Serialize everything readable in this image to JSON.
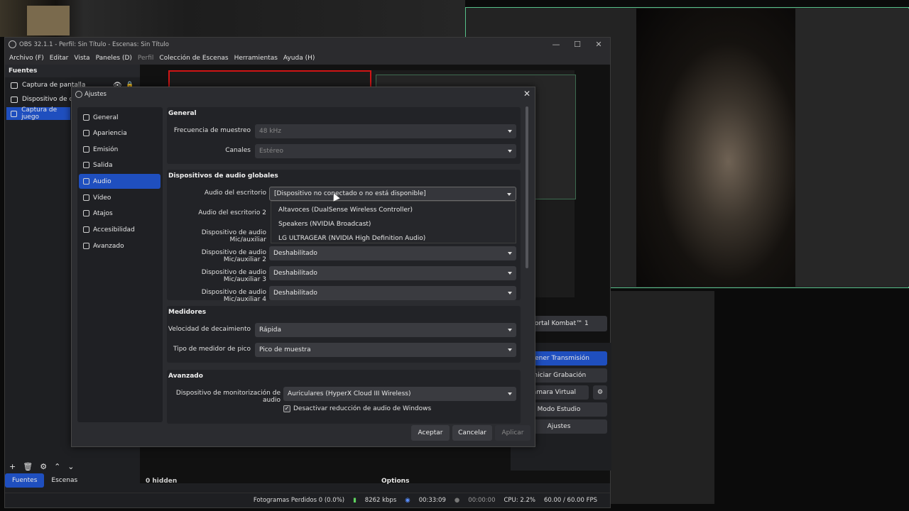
{
  "obs": {
    "title": "OBS 32.1.1 - Perfil: Sin Título - Escenas: Sin Título",
    "menu": [
      "Archivo (F)",
      "Editar",
      "Vista",
      "Paneles (D)",
      "Perfil",
      "Colección de Escenas",
      "Herramientas",
      "Ayuda (H)"
    ],
    "window_controls": [
      "—",
      "☐",
      "✕"
    ]
  },
  "sources": {
    "header": "Fuentes",
    "items": [
      "Captura de pantalla",
      "Dispositivo de cap",
      "Captura de juego"
    ],
    "selected_index": 2
  },
  "bottom_tabs": [
    "Fuentes",
    "Escenas"
  ],
  "scene_selector": "ortal Kombat™ 1",
  "controls": {
    "header": "les",
    "buttons": [
      "etener Transmisión",
      "Iniciar Grabación",
      "r Cámara Virtual",
      "Modo Estudio",
      "Ajustes"
    ]
  },
  "preview_footer": {
    "hidden": "0 hidden",
    "options": "Options"
  },
  "statusbar": {
    "dropped": "Fotogramas Perdidos 0 (0.0%)",
    "kbps": "8262 kbps",
    "stream_time": "00:33:09",
    "rec_time": "00:00:00",
    "cpu": "CPU: 2.2%",
    "fps": "60.00 / 60.00 FPS"
  },
  "settings": {
    "title": "Ajustes",
    "close": "✕",
    "nav": [
      "General",
      "Apariencia",
      "Emisión",
      "Salida",
      "Audio",
      "Vídeo",
      "Atajos",
      "Accesibilidad",
      "Avanzado"
    ],
    "nav_selected": 4,
    "general": {
      "title": "General",
      "sample_rate_label": "Frecuencia de muestreo",
      "sample_rate": "48 kHz",
      "channels_label": "Canales",
      "channels": "Estéreo"
    },
    "global_devices": {
      "title": "Dispositivos de audio globales",
      "desktop_label": "Audio del escritorio",
      "desktop_value": "[Dispositivo no conectado o no está disponible]",
      "desktop2_label": "Audio del escritorio 2",
      "mic1_label": "Dispositivo de audio Mic/auxiliar",
      "mic2_label": "Dispositivo de audio Mic/auxiliar 2",
      "mic2_value": "Deshabilitado",
      "mic3_label": "Dispositivo de audio Mic/auxiliar 3",
      "mic3_value": "Deshabilitado",
      "mic4_label": "Dispositivo de audio Mic/auxiliar 4",
      "mic4_value": "Deshabilitado",
      "dropdown_options": [
        "Altavoces (DualSense Wireless Controller)",
        "Speakers (NVIDIA Broadcast)",
        "LG ULTRAGEAR (NVIDIA High Definition Audio)"
      ]
    },
    "meters": {
      "title": "Medidores",
      "decay_label": "Velocidad de decaimiento",
      "decay_value": "Rápida",
      "peak_label": "Tipo de medidor de pico",
      "peak_value": "Pico de muestra"
    },
    "advanced": {
      "title": "Avanzado",
      "monitor_label": "Dispositivo de monitorización de audio",
      "monitor_value": "Auriculares (HyperX Cloud III Wireless)",
      "ducking_label": "Desactivar reducción de audio de Windows",
      "ducking_checked": true
    },
    "buttons": {
      "accept": "Aceptar",
      "cancel": "Cancelar",
      "apply": "Aplicar"
    }
  }
}
